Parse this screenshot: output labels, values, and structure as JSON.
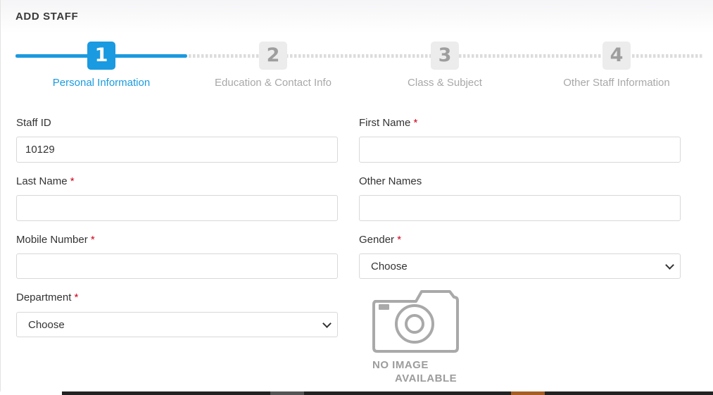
{
  "header": {
    "title": "ADD STAFF"
  },
  "stepper": {
    "steps": [
      {
        "number": "1",
        "label": "Personal Information"
      },
      {
        "number": "2",
        "label": "Education & Contact Info"
      },
      {
        "number": "3",
        "label": "Class & Subject"
      },
      {
        "number": "4",
        "label": "Other Staff Information"
      }
    ],
    "active_step": 1
  },
  "form": {
    "staff_id": {
      "label": "Staff ID",
      "value": "10129"
    },
    "first_name": {
      "label": "First Name",
      "required": "*",
      "value": ""
    },
    "last_name": {
      "label": "Last Name",
      "required": "*",
      "value": ""
    },
    "other_names": {
      "label": "Other Names",
      "value": ""
    },
    "mobile_number": {
      "label": "Mobile Number",
      "required": "*",
      "value": ""
    },
    "gender": {
      "label": "Gender",
      "required": "*",
      "selected": "Choose"
    },
    "department": {
      "label": "Department",
      "required": "*",
      "selected": "Choose"
    }
  },
  "photo": {
    "line1": "NO IMAGE",
    "line2": "AVAILABLE"
  },
  "colors": {
    "accent": "#1a9ae0",
    "required": "#d0021b",
    "inactive_step": "#ececec"
  },
  "icons": {
    "photo_placeholder": "camera-icon",
    "select_arrow": "chevron-down-icon"
  }
}
